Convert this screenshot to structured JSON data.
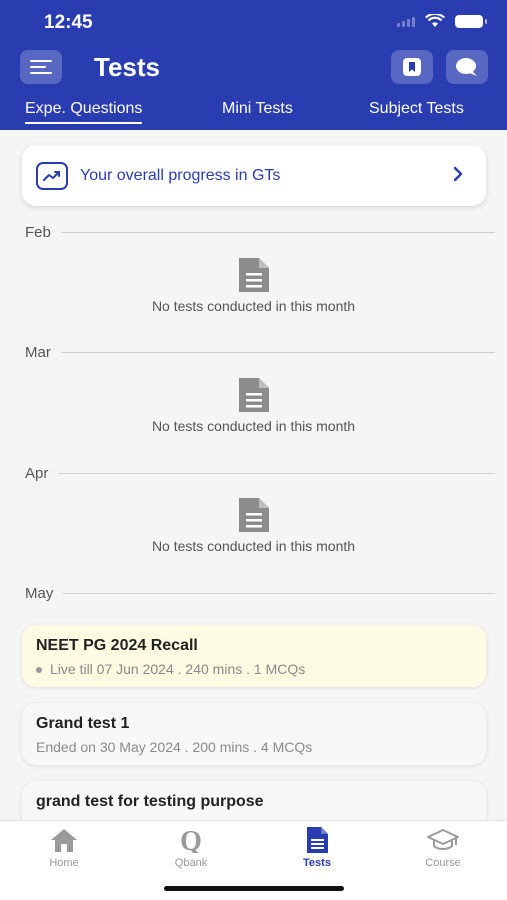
{
  "status": {
    "time": "12:45"
  },
  "header": {
    "title": "Tests"
  },
  "tabs": [
    {
      "label": "Expe. Questions",
      "active": true
    },
    {
      "label": "Mini Tests",
      "active": false
    },
    {
      "label": "Subject Tests",
      "active": false
    }
  ],
  "progress_card": {
    "text": "Your overall progress in GTs"
  },
  "months": [
    {
      "label": "Feb",
      "empty_text": "No tests conducted in this month"
    },
    {
      "label": "Mar",
      "empty_text": "No tests conducted in this month"
    },
    {
      "label": "Apr",
      "empty_text": "No tests conducted in this month"
    },
    {
      "label": "May"
    }
  ],
  "tests": [
    {
      "title": "NEET PG 2024 Recall",
      "meta": "Live till 07 Jun 2024 . 240 mins . 1 MCQs",
      "status": "live"
    },
    {
      "title": "Grand test 1",
      "meta": "Ended on 30 May 2024 . 200 mins . 4 MCQs",
      "status": "ended"
    },
    {
      "title": "grand test  for testing purpose",
      "meta": "",
      "status": "ended"
    }
  ],
  "bottom_nav": [
    {
      "label": "Home",
      "icon": "home-icon"
    },
    {
      "label": "Qbank",
      "icon": "qbank-icon"
    },
    {
      "label": "Tests",
      "icon": "tests-icon",
      "active": true
    },
    {
      "label": "Course",
      "icon": "course-icon"
    }
  ],
  "colors": {
    "primary": "#2a3db0",
    "live_card": "#fdfbe2"
  }
}
